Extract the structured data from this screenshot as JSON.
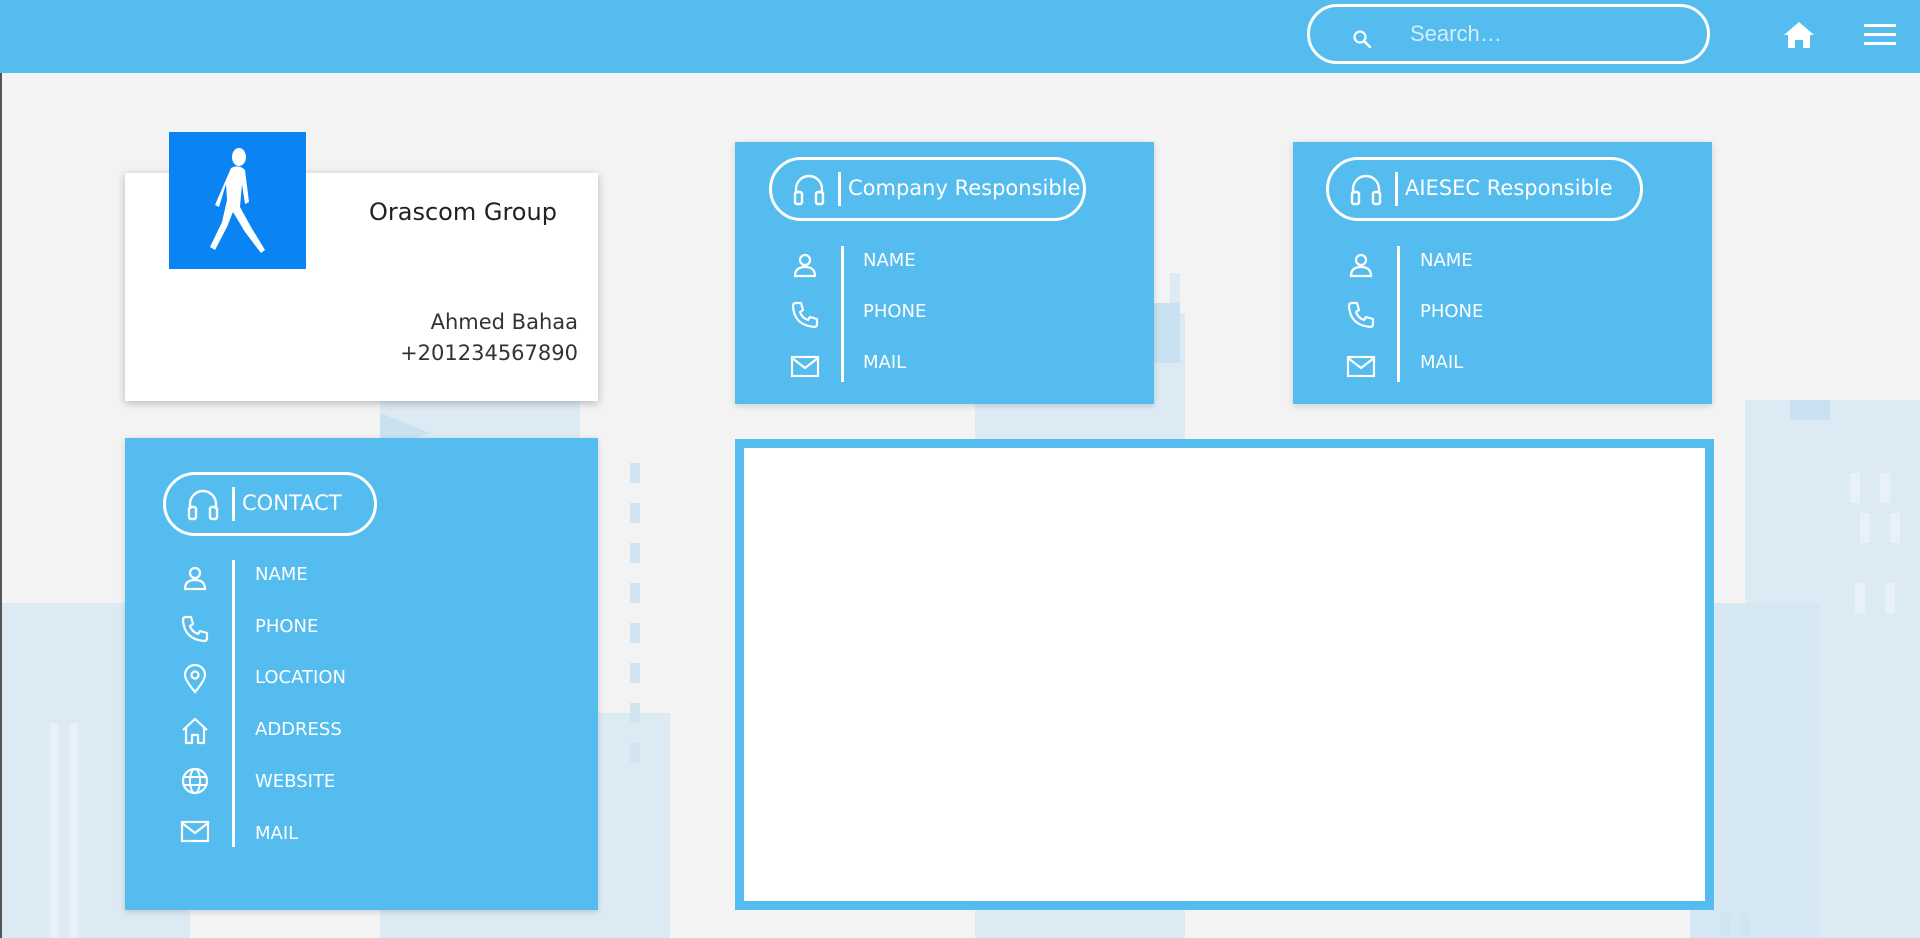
{
  "search": {
    "placeholder": "Search…"
  },
  "company": {
    "name": "Orascom Group",
    "person": "Ahmed Bahaa",
    "phone": "+201234567890"
  },
  "company_responsible": {
    "title": "Company Responsible",
    "rows": [
      "NAME",
      "PHONE",
      "MAIL"
    ]
  },
  "aiesec_responsible": {
    "title": "AIESEC Responsible",
    "rows": [
      "NAME",
      "PHONE",
      "MAIL"
    ]
  },
  "contact": {
    "title": "CONTACT",
    "rows": [
      "NAME",
      "PHONE",
      "LOCATION",
      "ADDRESS",
      "WEBSITE",
      "MAIL"
    ]
  },
  "icons": {
    "search": "search-icon",
    "home": "home-icon",
    "menu": "hamburger-menu-icon",
    "headset": "headset-icon",
    "person": "person-icon",
    "phone": "phone-icon",
    "location": "location-pin-icon",
    "address": "house-icon",
    "website": "globe-icon",
    "mail": "mail-icon",
    "logo": "walking-man-icon"
  },
  "colors": {
    "accent": "#54bcef",
    "logo_bg": "#0a84f2",
    "background": "#f3f3f3",
    "white": "#ffffff"
  }
}
